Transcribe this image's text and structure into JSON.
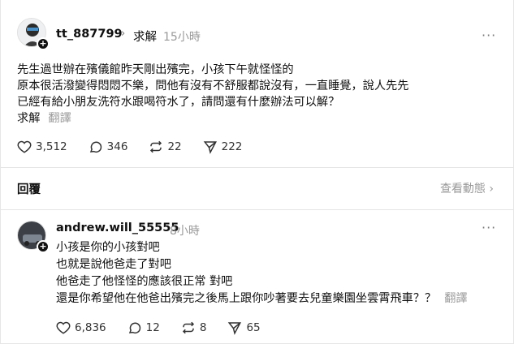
{
  "post": {
    "username": "tt_887799",
    "separator": "›",
    "tag": "求解",
    "time": "15小時",
    "more": "···",
    "lines": [
      "先生過世辦在殯儀館昨天剛出殯完，小孩下午就怪怪的",
      "原本很活潑變得悶悶不樂，問他有沒有不舒服都說沒有，一直睡覺，說人先先",
      "已經有給小朋友洗符水跟喝符水了，請問還有什麼辦法可以解？",
      "求解"
    ],
    "translate": "翻譯",
    "likes": "3,512",
    "comments": "346",
    "reposts": "22",
    "shares": "222"
  },
  "replies_header": {
    "label": "回覆",
    "activity": "查看動態 ›"
  },
  "reply": {
    "username": "andrew.will_55555",
    "time": "8小時",
    "more": "···",
    "lines": [
      "小孩是你的小孩對吧",
      "也就是說他爸走了對吧",
      "他爸走了他怪怪的應該很正常 對吧",
      "還是你希望他在他爸出殯完之後馬上跟你吵著要去兒童樂園坐雲霄飛車？？"
    ],
    "translate": "翻譯",
    "likes": "6,836",
    "comments": "12",
    "reposts": "8",
    "shares": "65"
  }
}
